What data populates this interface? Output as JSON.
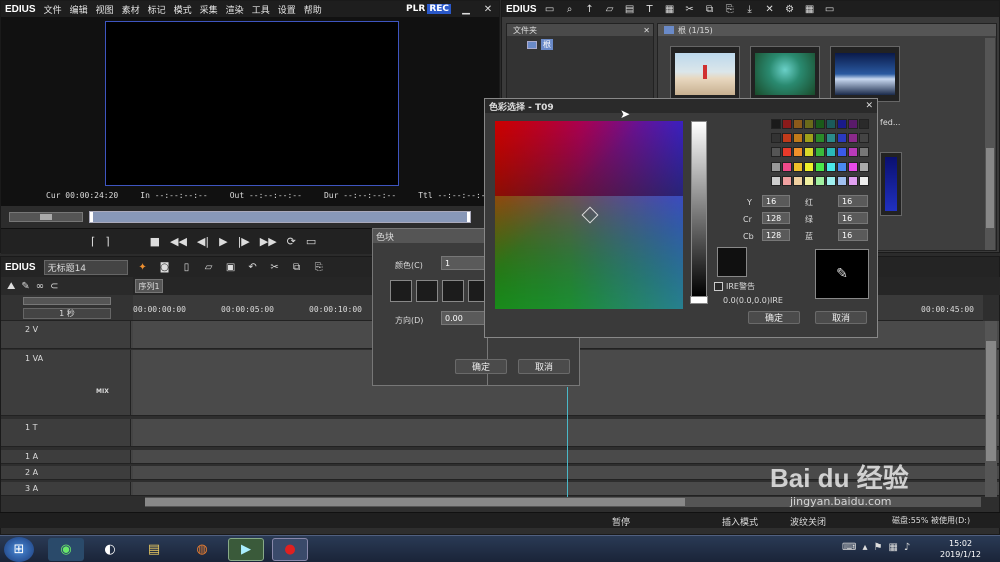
{
  "player": {
    "logo": "EDIUS",
    "menus": [
      "文件",
      "编辑",
      "视图",
      "素材",
      "标记",
      "模式",
      "采集",
      "渲染",
      "工具",
      "设置",
      "帮助"
    ],
    "plr": "PLR",
    "rec": "REC",
    "cur": "Cur 00:00:24:20",
    "in": "In --:--:--:--",
    "out": "Out --:--:--:--",
    "dur": "Dur --:--:--:--",
    "ttl": "Ttl --:--:--:--"
  },
  "bin": {
    "logo": "EDIUS",
    "folder_header": "文件夹",
    "root": "根",
    "root_count": "根 (1/15)",
    "clip_partial": "fed..."
  },
  "timeline": {
    "logo": "EDIUS",
    "project": "无标题14",
    "sequence_tab": "序列1",
    "scale": "1 秒",
    "tc_0": "00:00:00:00",
    "tc_1": "00:00:05:00",
    "tc_2": "00:00:10:00",
    "tc_end": "00:00:45:00",
    "tracks": [
      "2 V",
      "1 VA",
      "1 T",
      "1 A",
      "2 A",
      "3 A"
    ],
    "mix": "MIX"
  },
  "status": {
    "pause": "暂停",
    "insert_mode": "插入模式",
    "ripple_off": "波纹关闭",
    "disk": "磁盘:55% 被使用(D:)"
  },
  "color_block": {
    "title": "色块",
    "color_label": "颜色(C)",
    "color_value": "1",
    "direction_label": "方向(D)",
    "direction_value": "0.00",
    "ok": "确定",
    "cancel": "取消"
  },
  "color_picker": {
    "title": "色彩选择 - T09",
    "y_label": "Y",
    "y_value": "16",
    "cr_label": "Cr",
    "cr_value": "128",
    "cb_label": "Cb",
    "cb_value": "128",
    "r_label": "红",
    "r_value": "16",
    "g_label": "绿",
    "g_value": "16",
    "b_label": "蓝",
    "b_value": "16",
    "ire_warning": "IRE警告",
    "ire_value": "0.0(0.0,0.0)IRE",
    "ok": "确定",
    "cancel": "取消",
    "swatches": [
      "#1a1a1a",
      "#8a1a1a",
      "#8a5a1a",
      "#6a6a1a",
      "#1a5a1a",
      "#1a5a5a",
      "#1a1a8a",
      "#5a1a6a",
      "#2a2a2a",
      "#333333",
      "#c03a1a",
      "#c07a1a",
      "#a0a01a",
      "#2a8a2a",
      "#2a8a8a",
      "#2a3ac0",
      "#8a2a8a",
      "#444444",
      "#555555",
      "#e83a2a",
      "#f0902a",
      "#d8d82a",
      "#3ab83a",
      "#2ab8b8",
      "#3a5ae8",
      "#b83ab8",
      "#777777",
      "#999999",
      "#f04a8a",
      "#f0c02a",
      "#f0f02a",
      "#4ae84a",
      "#4ae8e8",
      "#4a8af0",
      "#e84ae8",
      "#aaaaaa",
      "#cccccc",
      "#f0a0a0",
      "#f0d0a0",
      "#f0f0a0",
      "#a0f0a0",
      "#a0f0f0",
      "#a0c0f0",
      "#e0a0f0",
      "#eeeeee"
    ]
  },
  "taskbar": {
    "time": "15:02",
    "date": "2019/1/12"
  },
  "watermark": {
    "brand": "Bai du 经验",
    "url": "jingyan.baidu.com"
  }
}
